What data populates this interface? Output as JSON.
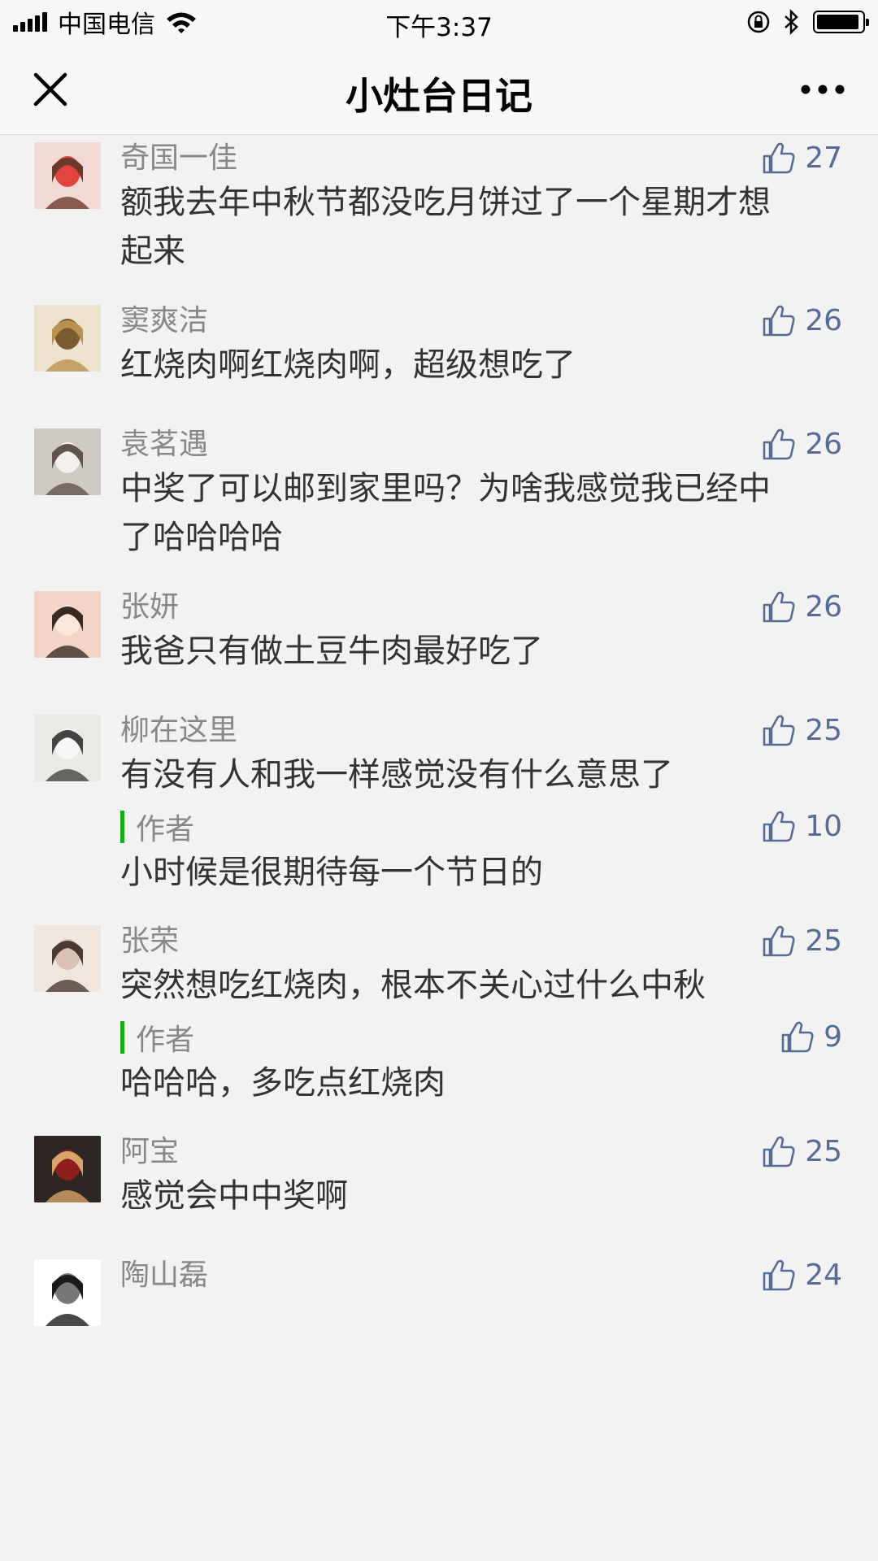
{
  "status_bar": {
    "carrier": "中国电信",
    "time": "下午3:37"
  },
  "nav": {
    "title": "小灶台日记",
    "close_icon": "close-icon",
    "more_icon": "more-icon"
  },
  "colors": {
    "like_blue": "#576b95",
    "author_green": "#1aad19",
    "name_gray": "#888888",
    "text_dark": "#333333"
  },
  "comments": [
    {
      "name": "奇国一佳",
      "likes": "27",
      "text": [
        "额我去年中秋节都没吃月饼过了一个星期才想",
        "起来"
      ],
      "avatar_colors": [
        "#f3d9d4",
        "#6b3b2a",
        "#e0443c"
      ]
    },
    {
      "name": "窦爽洁",
      "likes": "26",
      "text": [
        "红烧肉啊红烧肉啊，超级想吃了"
      ],
      "avatar_colors": [
        "#ece3cf",
        "#b9924f",
        "#7a5a2e"
      ]
    },
    {
      "name": "袁茗遇",
      "likes": "26",
      "text": [
        "中奖了可以邮到家里吗？为啥我感觉我已经中",
        "了哈哈哈哈"
      ],
      "avatar_colors": [
        "#cfc9c4",
        "#5f5450",
        "#f4f0ec"
      ]
    },
    {
      "name": "张妍",
      "likes": "26",
      "text": [
        "我爸只有做土豆牛肉最好吃了"
      ],
      "avatar_colors": [
        "#f2d5c4",
        "#3b2a24",
        "#fbe7dc"
      ]
    },
    {
      "name": "柳在这里",
      "likes": "25",
      "text": [
        "有没有人和我一样感觉没有什么意思了"
      ],
      "avatar_colors": [
        "#e9e9e6",
        "#444444",
        "#f8f8f6"
      ],
      "reply": {
        "label": "作者",
        "likes": "10",
        "text": "小时候是很期待每一个节日的"
      }
    },
    {
      "name": "张荣",
      "likes": "25",
      "text": [
        "突然想吃红烧肉，根本不关心过什么中秋"
      ],
      "avatar_colors": [
        "#efe6df",
        "#4a3a33",
        "#d9c1b3"
      ],
      "reply": {
        "label": "作者",
        "likes": "9",
        "text": "哈哈哈，多吃点红烧肉"
      }
    },
    {
      "name": "阿宝",
      "likes": "25",
      "text": [
        "感觉会中中奖啊"
      ],
      "avatar_colors": [
        "#2d2622",
        "#d7a46a",
        "#8f1f1f"
      ]
    },
    {
      "name": "陶山磊",
      "likes": "24",
      "text": [
        ""
      ],
      "avatar_colors": [
        "#ffffff",
        "#1a1a1a",
        "#777777"
      ]
    }
  ]
}
